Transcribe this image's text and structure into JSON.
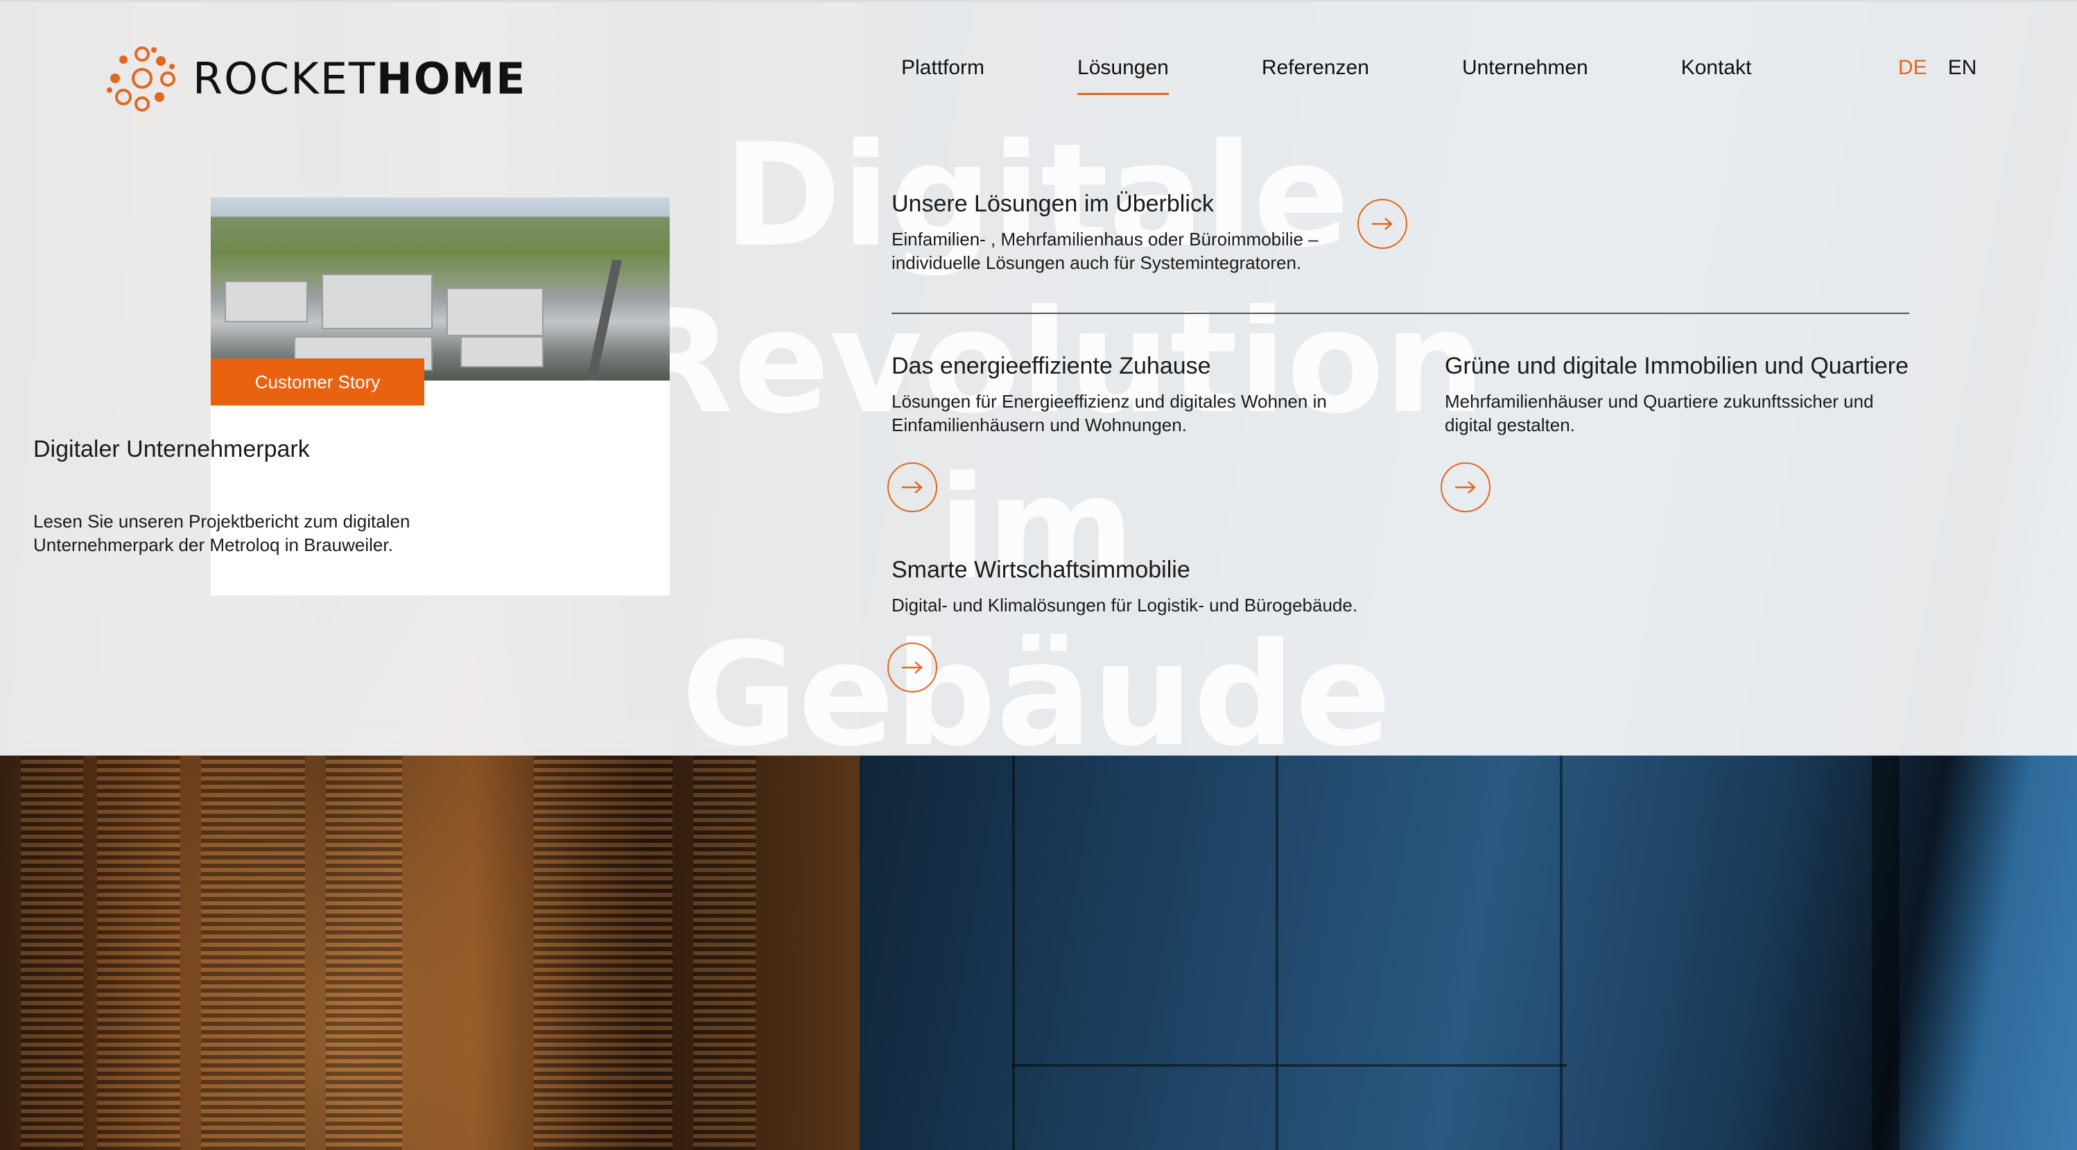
{
  "brand": {
    "logo_light": "ROCKET",
    "logo_bold": "HOME",
    "accent": "#e2671f"
  },
  "nav": {
    "items": [
      {
        "label": "Plattform"
      },
      {
        "label": "Lösungen"
      },
      {
        "label": "Referenzen"
      },
      {
        "label": "Unternehmen"
      },
      {
        "label": "Kontakt"
      }
    ],
    "active": "Lösungen"
  },
  "language": {
    "de": "DE",
    "en": "EN",
    "selected": "DE"
  },
  "watermark": {
    "line1": "Digitale",
    "line2": "Revolution",
    "line3": "im",
    "line4": "Gebäude"
  },
  "story_card": {
    "badge": "Customer Story",
    "title": "Digitaler Unternehmerpark",
    "text": "Lesen Sie unseren Projektbericht zum digitalen Unternehmerpark der Metroloq in Brauweiler."
  },
  "solutions": {
    "overview": {
      "title": "Unsere Lösungen im Überblick",
      "line1": "Einfamilien- , Mehrfamilienhaus oder Büroimmobilie –",
      "line2": "individuelle Lösungen auch für Systemintegratoren."
    },
    "home": {
      "title": "Das energieeffiziente Zuhause",
      "line1": "Lösungen für Energieeffizienz und digitales Wohnen in",
      "line2": "Einfamilienhäusern und Wohnungen."
    },
    "quarters": {
      "title": "Grüne und digitale Immobilien und Quartiere",
      "line1": "Mehrfamilienhäuser und Quartiere zukunftssicher und",
      "line2": "digital gestalten."
    },
    "commercial": {
      "title": "Smarte Wirtschaftsimmobilie",
      "line1": "Digital- und Klimalösungen für Logistik- und Bürogebäude."
    }
  },
  "icons": {
    "arrow": "arrow-right-icon",
    "logo": "rocket-dots-logo-icon"
  }
}
